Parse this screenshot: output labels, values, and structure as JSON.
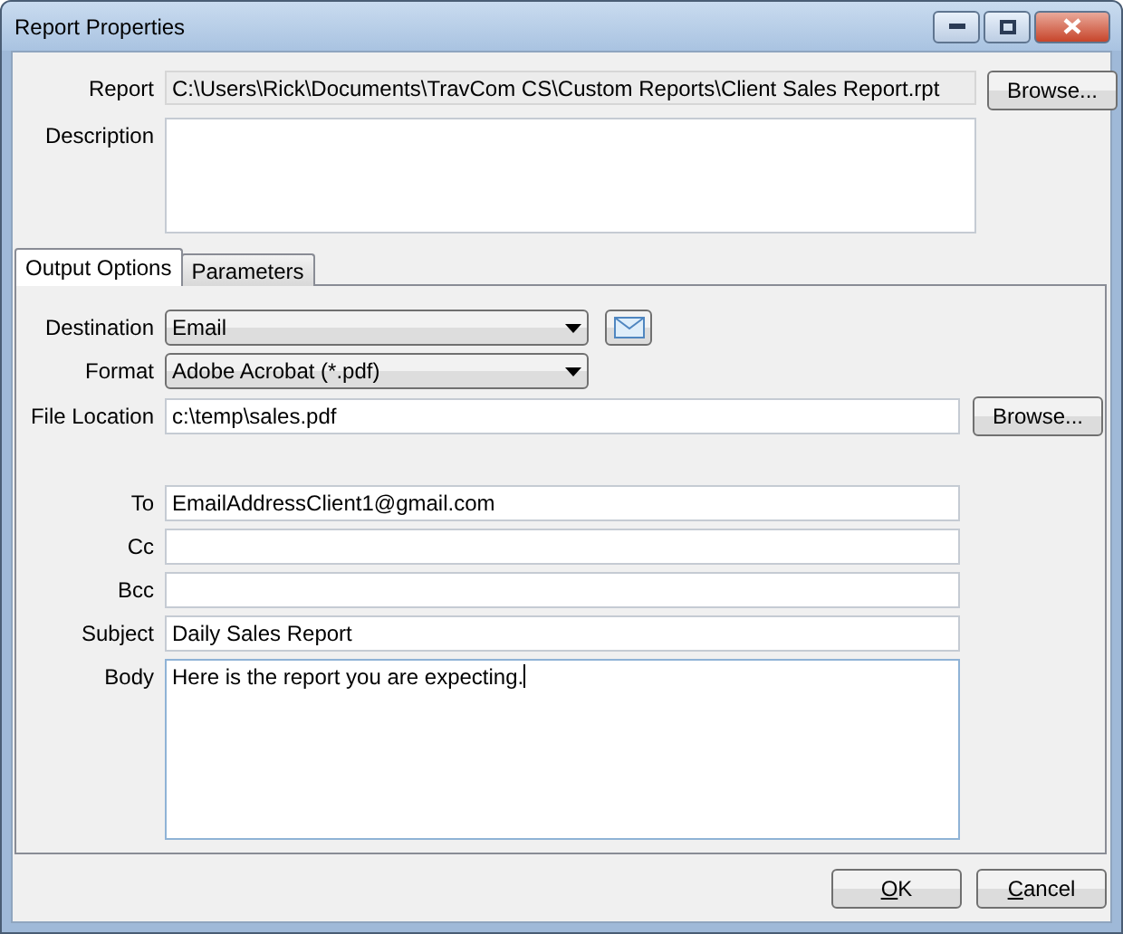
{
  "window": {
    "title": "Report Properties"
  },
  "report": {
    "label": "Report",
    "value": "C:\\Users\\Rick\\Documents\\TravCom CS\\Custom Reports\\Client Sales Report.rpt",
    "browse": "Browse..."
  },
  "description": {
    "label": "Description"
  },
  "tabs": [
    {
      "label": "Output Options",
      "selected": true
    },
    {
      "label": "Parameters",
      "selected": false
    }
  ],
  "output": {
    "destination": {
      "label": "Destination",
      "value": "Email"
    },
    "format": {
      "label": "Format",
      "value": "Adobe Acrobat (*.pdf)"
    },
    "file_location": {
      "label": "File Location",
      "value": "c:\\temp\\sales.pdf",
      "browse": "Browse..."
    }
  },
  "email": [
    {
      "label": "To",
      "value": "EmailAddressClient1@gmail.com",
      "kind": "line"
    },
    {
      "label": "Cc",
      "kind": "line"
    },
    {
      "label": "Bcc",
      "kind": "line"
    },
    {
      "label": "Subject",
      "value": "Daily Sales Report",
      "kind": "line"
    },
    {
      "label": "Body",
      "value": "Here is the report you are expecting.",
      "kind": "multiline"
    }
  ],
  "buttons": [
    "OK",
    "Cancel"
  ]
}
